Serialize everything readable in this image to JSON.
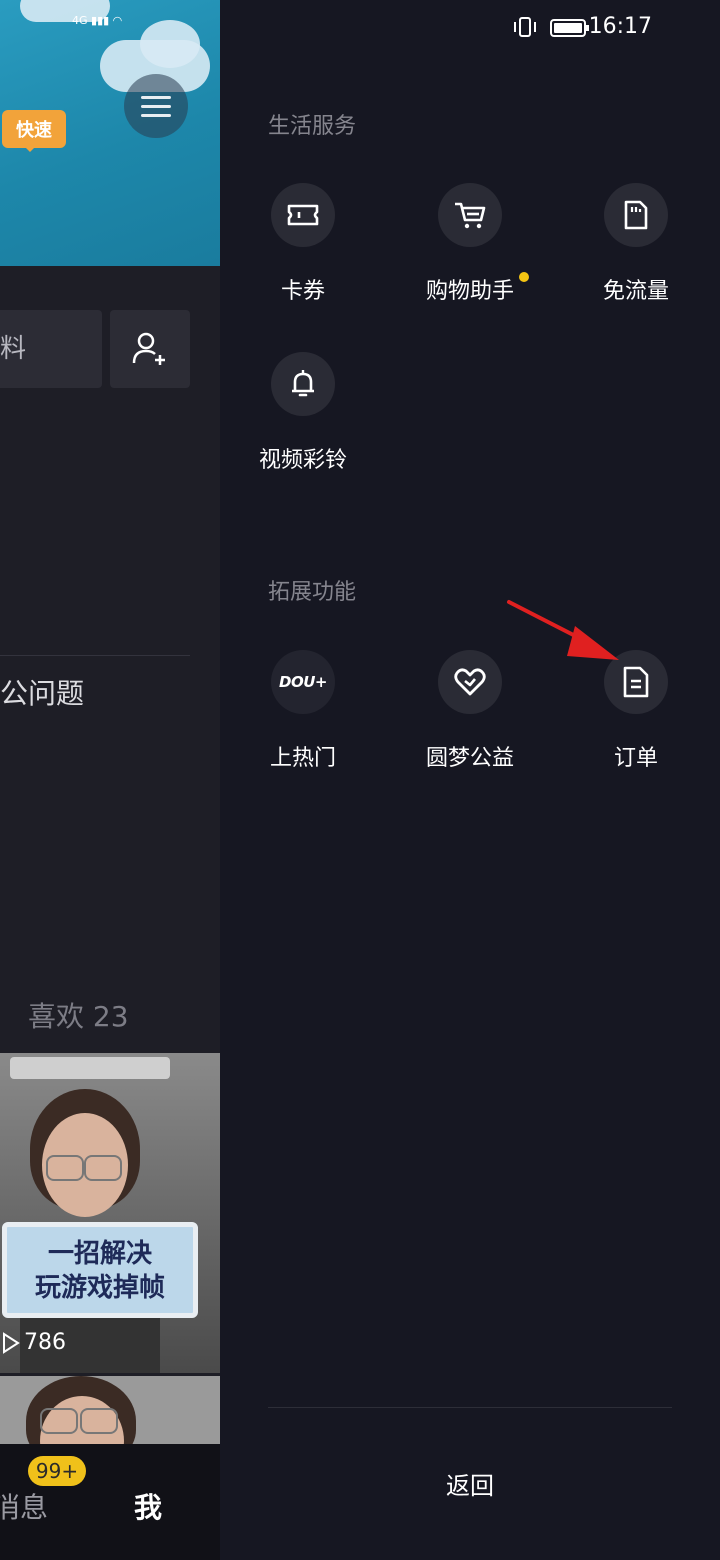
{
  "status_bar": {
    "time": "16:17",
    "network": "4G"
  },
  "left_panel": {
    "banner_bubble": "快速",
    "input_partial": "料",
    "faq_partial": "公问题",
    "likes_label": "喜欢 23",
    "video_caption_line1": "一招解决",
    "video_caption_line2": "玩游戏掉帧",
    "video_views": "786",
    "nav_messages_partial": "消息",
    "nav_messages_badge": "99+",
    "nav_me": "我"
  },
  "drawer": {
    "sections": [
      {
        "title": "生活服务",
        "items": [
          {
            "label": "卡券",
            "icon": "ticket-icon"
          },
          {
            "label": "购物助手",
            "icon": "cart-icon",
            "has_dot": true
          },
          {
            "label": "免流量",
            "icon": "sim-card-icon"
          },
          {
            "label": "视频彩铃",
            "icon": "bell-icon"
          }
        ]
      },
      {
        "title": "拓展功能",
        "items": [
          {
            "label": "上热门",
            "icon": "dou-plus-icon"
          },
          {
            "label": "圆梦公益",
            "icon": "heart-icon"
          },
          {
            "label": "订单",
            "icon": "order-document-icon"
          }
        ]
      }
    ],
    "dou_plus_text": "DOU+",
    "back_label": "返回"
  },
  "colors": {
    "drawer_bg": "#161722",
    "icon_circle": "#2a2b35",
    "section_title": "#85858e",
    "badge": "#f0c11a",
    "arrow": "#e02020"
  }
}
